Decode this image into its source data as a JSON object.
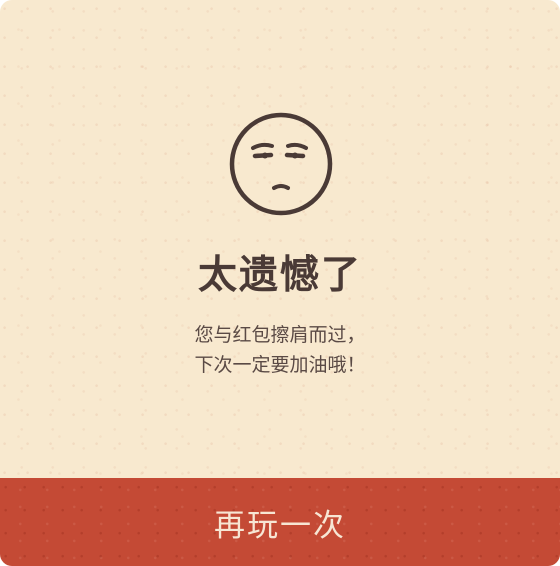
{
  "result": {
    "icon": "disappointed-face-icon",
    "title": "太遗憾了",
    "message_lines": [
      "您与红包擦肩而过，",
      "下次一定要加油哦！"
    ]
  },
  "actions": {
    "replay_label": "再玩一次"
  },
  "colors": {
    "background": "#f8e9cf",
    "text": "#4a3a36",
    "button": "#c44a35",
    "button_text": "#f7e6d4"
  }
}
